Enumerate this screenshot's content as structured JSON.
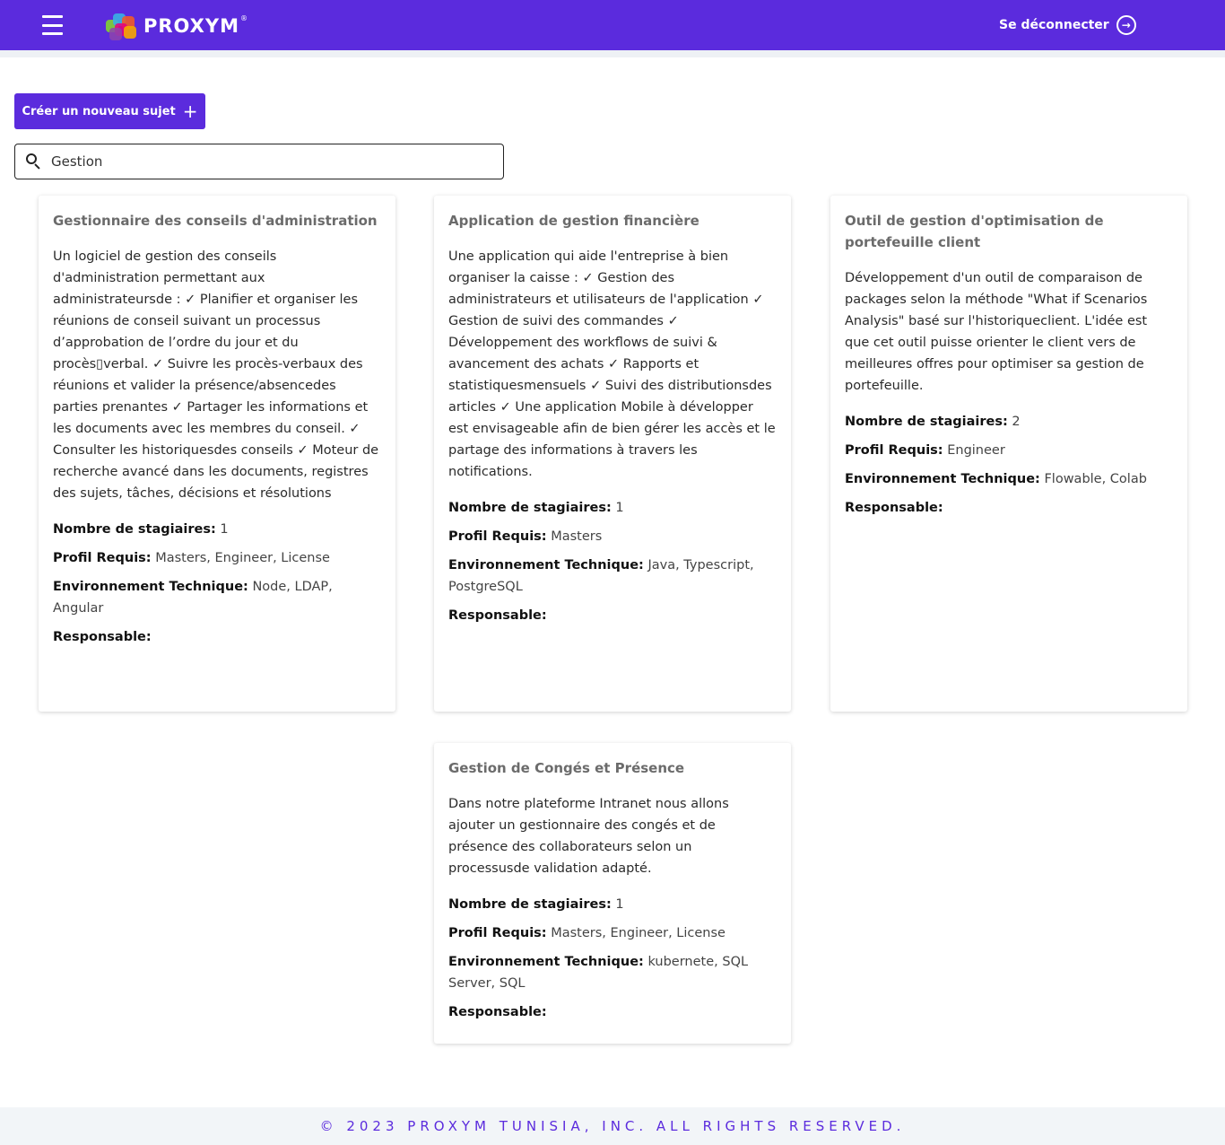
{
  "header": {
    "logo_text": "PROXYM",
    "logo_registered": "®",
    "logout_label": "Se déconnecter"
  },
  "toolbar": {
    "create_label": "Créer un nouveau sujet",
    "create_icon": "+"
  },
  "search": {
    "value": "Gestion",
    "icon": "search-icon"
  },
  "labels": {
    "interns": "Nombre de stagiaires:",
    "profile": "Profil Requis:",
    "tech": "Environnement Technique:",
    "manager": "Responsable:"
  },
  "cards": [
    {
      "title": "Gestionnaire des conseils d'administration",
      "description": "Un logiciel de gestion des conseils d'administration permettant aux administrateursde : ✓ Planifier et organiser les réunions de conseil suivant un processus d’approbation de l’ordre du jour et du procès▯verbal. ✓ Suivre les procès-verbaux des réunions et valider la présence/absencedes parties prenantes ✓ Partager les informations et les documents avec les membres du conseil. ✓ Consulter les historiquesdes conseils ✓ Moteur de recherche avancé dans les documents, registres des sujets, tâches, décisions et résolutions",
      "interns": "1",
      "profile": "Masters, Engineer, License",
      "tech": "Node, LDAP, Angular",
      "manager": ""
    },
    {
      "title": "Application de gestion financière",
      "description": "Une application qui aide l'entreprise à bien organiser la caisse : ✓ Gestion des administrateurs et utilisateurs de l'application ✓ Gestion de suivi des commandes ✓ Développement des workflows de suivi & avancement des achats ✓ Rapports et statistiquesmensuels ✓ Suivi des distributionsdes articles ✓ Une application Mobile à développer est envisageable afin de bien gérer les accès et le partage des informations à travers les notifications.",
      "interns": "1",
      "profile": "Masters",
      "tech": "Java, Typescript, PostgreSQL",
      "manager": ""
    },
    {
      "title": "Outil de gestion d'optimisation de portefeuille client",
      "description": "Développement d'un outil de comparaison de packages selon la méthode \"What if Scenarios Analysis\" basé sur l'historiqueclient. L'idée est que cet outil puisse orienter le client vers de meilleures offres pour optimiser sa gestion de portefeuille.",
      "interns": "2",
      "profile": "Engineer",
      "tech": "Flowable, Colab",
      "manager": ""
    },
    {
      "title": "Gestion de Congés et Présence",
      "description": "Dans notre plateforme Intranet nous allons ajouter un gestionnaire des congés et de présence des collaborateurs selon un processusde validation adapté.",
      "interns": "1",
      "profile": "Masters, Engineer, License",
      "tech": "kubernete, SQL Server, SQL",
      "manager": ""
    }
  ],
  "footer": {
    "text": "© 2023 PROXYM TUNISIA, INC. ALL RIGHTS RESERVED."
  },
  "colors": {
    "brand": "#5b2bdd",
    "background": "#eef1f5"
  }
}
